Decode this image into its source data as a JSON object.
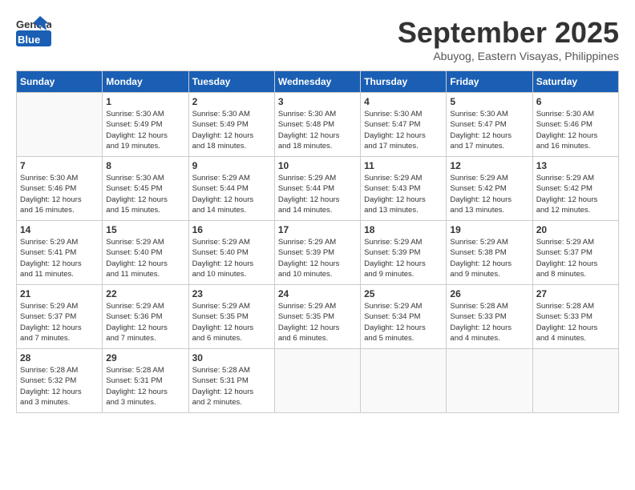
{
  "header": {
    "logo_general": "General",
    "logo_blue": "Blue",
    "month": "September 2025",
    "location": "Abuyog, Eastern Visayas, Philippines"
  },
  "days_of_week": [
    "Sunday",
    "Monday",
    "Tuesday",
    "Wednesday",
    "Thursday",
    "Friday",
    "Saturday"
  ],
  "weeks": [
    [
      {
        "day": "",
        "info": ""
      },
      {
        "day": "1",
        "info": "Sunrise: 5:30 AM\nSunset: 5:49 PM\nDaylight: 12 hours\nand 19 minutes."
      },
      {
        "day": "2",
        "info": "Sunrise: 5:30 AM\nSunset: 5:49 PM\nDaylight: 12 hours\nand 18 minutes."
      },
      {
        "day": "3",
        "info": "Sunrise: 5:30 AM\nSunset: 5:48 PM\nDaylight: 12 hours\nand 18 minutes."
      },
      {
        "day": "4",
        "info": "Sunrise: 5:30 AM\nSunset: 5:47 PM\nDaylight: 12 hours\nand 17 minutes."
      },
      {
        "day": "5",
        "info": "Sunrise: 5:30 AM\nSunset: 5:47 PM\nDaylight: 12 hours\nand 17 minutes."
      },
      {
        "day": "6",
        "info": "Sunrise: 5:30 AM\nSunset: 5:46 PM\nDaylight: 12 hours\nand 16 minutes."
      }
    ],
    [
      {
        "day": "7",
        "info": "Sunrise: 5:30 AM\nSunset: 5:46 PM\nDaylight: 12 hours\nand 16 minutes."
      },
      {
        "day": "8",
        "info": "Sunrise: 5:30 AM\nSunset: 5:45 PM\nDaylight: 12 hours\nand 15 minutes."
      },
      {
        "day": "9",
        "info": "Sunrise: 5:29 AM\nSunset: 5:44 PM\nDaylight: 12 hours\nand 14 minutes."
      },
      {
        "day": "10",
        "info": "Sunrise: 5:29 AM\nSunset: 5:44 PM\nDaylight: 12 hours\nand 14 minutes."
      },
      {
        "day": "11",
        "info": "Sunrise: 5:29 AM\nSunset: 5:43 PM\nDaylight: 12 hours\nand 13 minutes."
      },
      {
        "day": "12",
        "info": "Sunrise: 5:29 AM\nSunset: 5:42 PM\nDaylight: 12 hours\nand 13 minutes."
      },
      {
        "day": "13",
        "info": "Sunrise: 5:29 AM\nSunset: 5:42 PM\nDaylight: 12 hours\nand 12 minutes."
      }
    ],
    [
      {
        "day": "14",
        "info": "Sunrise: 5:29 AM\nSunset: 5:41 PM\nDaylight: 12 hours\nand 11 minutes."
      },
      {
        "day": "15",
        "info": "Sunrise: 5:29 AM\nSunset: 5:40 PM\nDaylight: 12 hours\nand 11 minutes."
      },
      {
        "day": "16",
        "info": "Sunrise: 5:29 AM\nSunset: 5:40 PM\nDaylight: 12 hours\nand 10 minutes."
      },
      {
        "day": "17",
        "info": "Sunrise: 5:29 AM\nSunset: 5:39 PM\nDaylight: 12 hours\nand 10 minutes."
      },
      {
        "day": "18",
        "info": "Sunrise: 5:29 AM\nSunset: 5:39 PM\nDaylight: 12 hours\nand 9 minutes."
      },
      {
        "day": "19",
        "info": "Sunrise: 5:29 AM\nSunset: 5:38 PM\nDaylight: 12 hours\nand 9 minutes."
      },
      {
        "day": "20",
        "info": "Sunrise: 5:29 AM\nSunset: 5:37 PM\nDaylight: 12 hours\nand 8 minutes."
      }
    ],
    [
      {
        "day": "21",
        "info": "Sunrise: 5:29 AM\nSunset: 5:37 PM\nDaylight: 12 hours\nand 7 minutes."
      },
      {
        "day": "22",
        "info": "Sunrise: 5:29 AM\nSunset: 5:36 PM\nDaylight: 12 hours\nand 7 minutes."
      },
      {
        "day": "23",
        "info": "Sunrise: 5:29 AM\nSunset: 5:35 PM\nDaylight: 12 hours\nand 6 minutes."
      },
      {
        "day": "24",
        "info": "Sunrise: 5:29 AM\nSunset: 5:35 PM\nDaylight: 12 hours\nand 6 minutes."
      },
      {
        "day": "25",
        "info": "Sunrise: 5:29 AM\nSunset: 5:34 PM\nDaylight: 12 hours\nand 5 minutes."
      },
      {
        "day": "26",
        "info": "Sunrise: 5:28 AM\nSunset: 5:33 PM\nDaylight: 12 hours\nand 4 minutes."
      },
      {
        "day": "27",
        "info": "Sunrise: 5:28 AM\nSunset: 5:33 PM\nDaylight: 12 hours\nand 4 minutes."
      }
    ],
    [
      {
        "day": "28",
        "info": "Sunrise: 5:28 AM\nSunset: 5:32 PM\nDaylight: 12 hours\nand 3 minutes."
      },
      {
        "day": "29",
        "info": "Sunrise: 5:28 AM\nSunset: 5:31 PM\nDaylight: 12 hours\nand 3 minutes."
      },
      {
        "day": "30",
        "info": "Sunrise: 5:28 AM\nSunset: 5:31 PM\nDaylight: 12 hours\nand 2 minutes."
      },
      {
        "day": "",
        "info": ""
      },
      {
        "day": "",
        "info": ""
      },
      {
        "day": "",
        "info": ""
      },
      {
        "day": "",
        "info": ""
      }
    ]
  ]
}
